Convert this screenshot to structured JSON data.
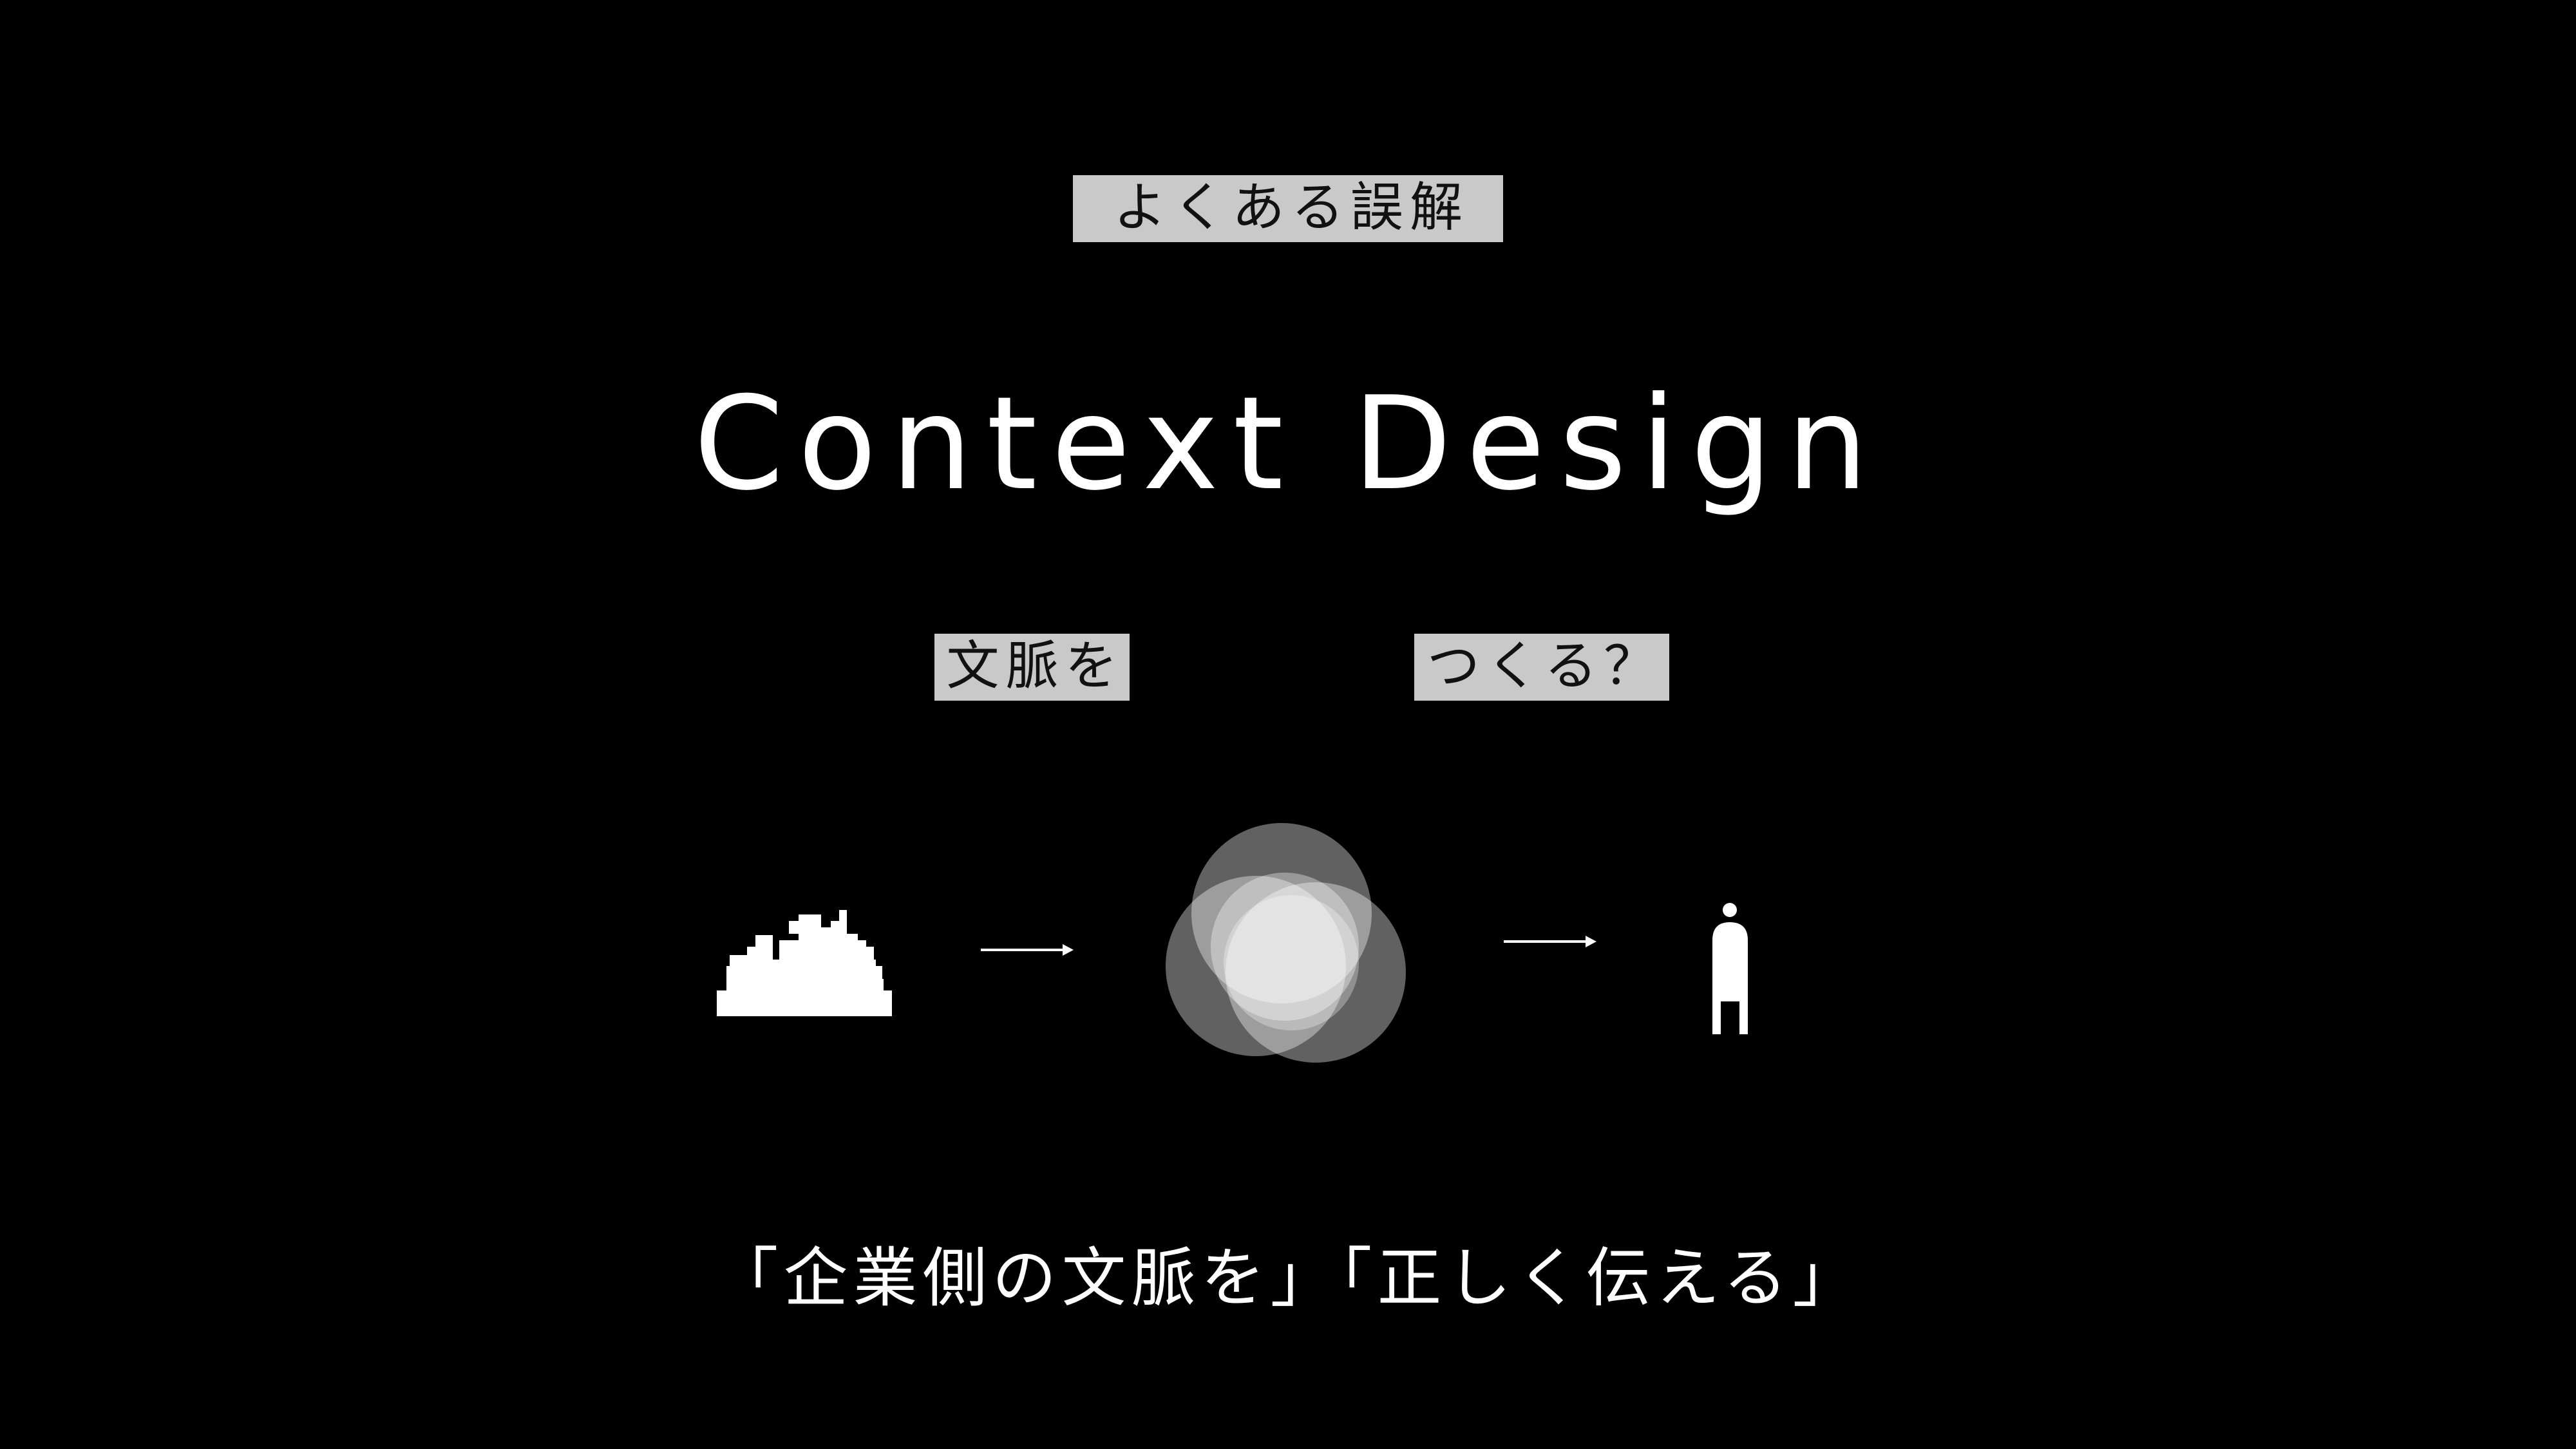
{
  "labels": {
    "misconception": "よくある誤解",
    "context": "文脈を",
    "create": "つくる？"
  },
  "title": "Context Design",
  "caption": "「企業側の文脈を」「正しく伝える」",
  "diagram": {
    "nodes": [
      "city-skyline-icon",
      "overlapping-circles-icon",
      "person-icon"
    ],
    "connectors": [
      "arrow-right-icon",
      "arrow-right-icon"
    ]
  },
  "colors": {
    "background": "#000000",
    "foreground": "#ffffff",
    "label_box": "#c9c9c9",
    "label_text": "#111111"
  }
}
